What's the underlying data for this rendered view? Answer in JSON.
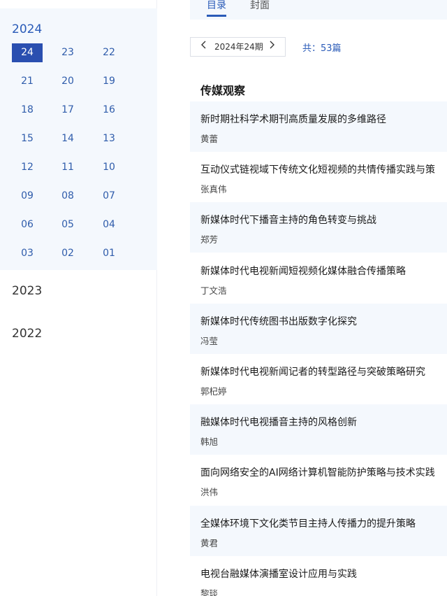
{
  "sidebar": {
    "active_year": "2024",
    "issues": [
      "24",
      "23",
      "22",
      "21",
      "20",
      "19",
      "18",
      "17",
      "16",
      "15",
      "14",
      "13",
      "12",
      "11",
      "10",
      "09",
      "08",
      "07",
      "06",
      "05",
      "04",
      "03",
      "02",
      "01"
    ],
    "active_issue": "24",
    "other_years": [
      "2023",
      "2022"
    ]
  },
  "tabs": [
    {
      "label": "目录",
      "active": true
    },
    {
      "label": "封面",
      "active": false
    }
  ],
  "pager": {
    "prev_icon": "chevron-left-icon",
    "label": "2024年24期",
    "next_icon": "chevron-right-icon"
  },
  "total": "共：53篇",
  "section": {
    "title": "传媒观察"
  },
  "articles": [
    {
      "title": "新时期社科学术期刊高质量发展的多维路径",
      "author": "黄蕾"
    },
    {
      "title": "互动仪式链视域下传统文化短视频的共情传播实践与策",
      "author": "张真伟"
    },
    {
      "title": "新媒体时代下播音主持的角色转变与挑战",
      "author": "郑芳"
    },
    {
      "title": "新媒体时代电视新闻短视频化媒体融合传播策略",
      "author": "丁文浩"
    },
    {
      "title": "新媒体时代传统图书出版数字化探究",
      "author": "冯莹"
    },
    {
      "title": "新媒体时代电视新闻记者的转型路径与突破策略研究",
      "author": "郭杞婷"
    },
    {
      "title": "融媒体时代电视播音主持的风格创新",
      "author": "韩旭"
    },
    {
      "title": "面向网络安全的AI网络计算机智能防护策略与技术实践",
      "author": "洪伟"
    },
    {
      "title": "全媒体环境下文化类节目主持人传播力的提升策略",
      "author": "黄君"
    },
    {
      "title": "电视台融媒体演播室设计应用与实践",
      "author": "黎琰"
    }
  ],
  "colors": {
    "accent": "#2a5bb8",
    "active_issue_bg": "#2a4fb0",
    "panel_bg": "#f4f8fd"
  }
}
